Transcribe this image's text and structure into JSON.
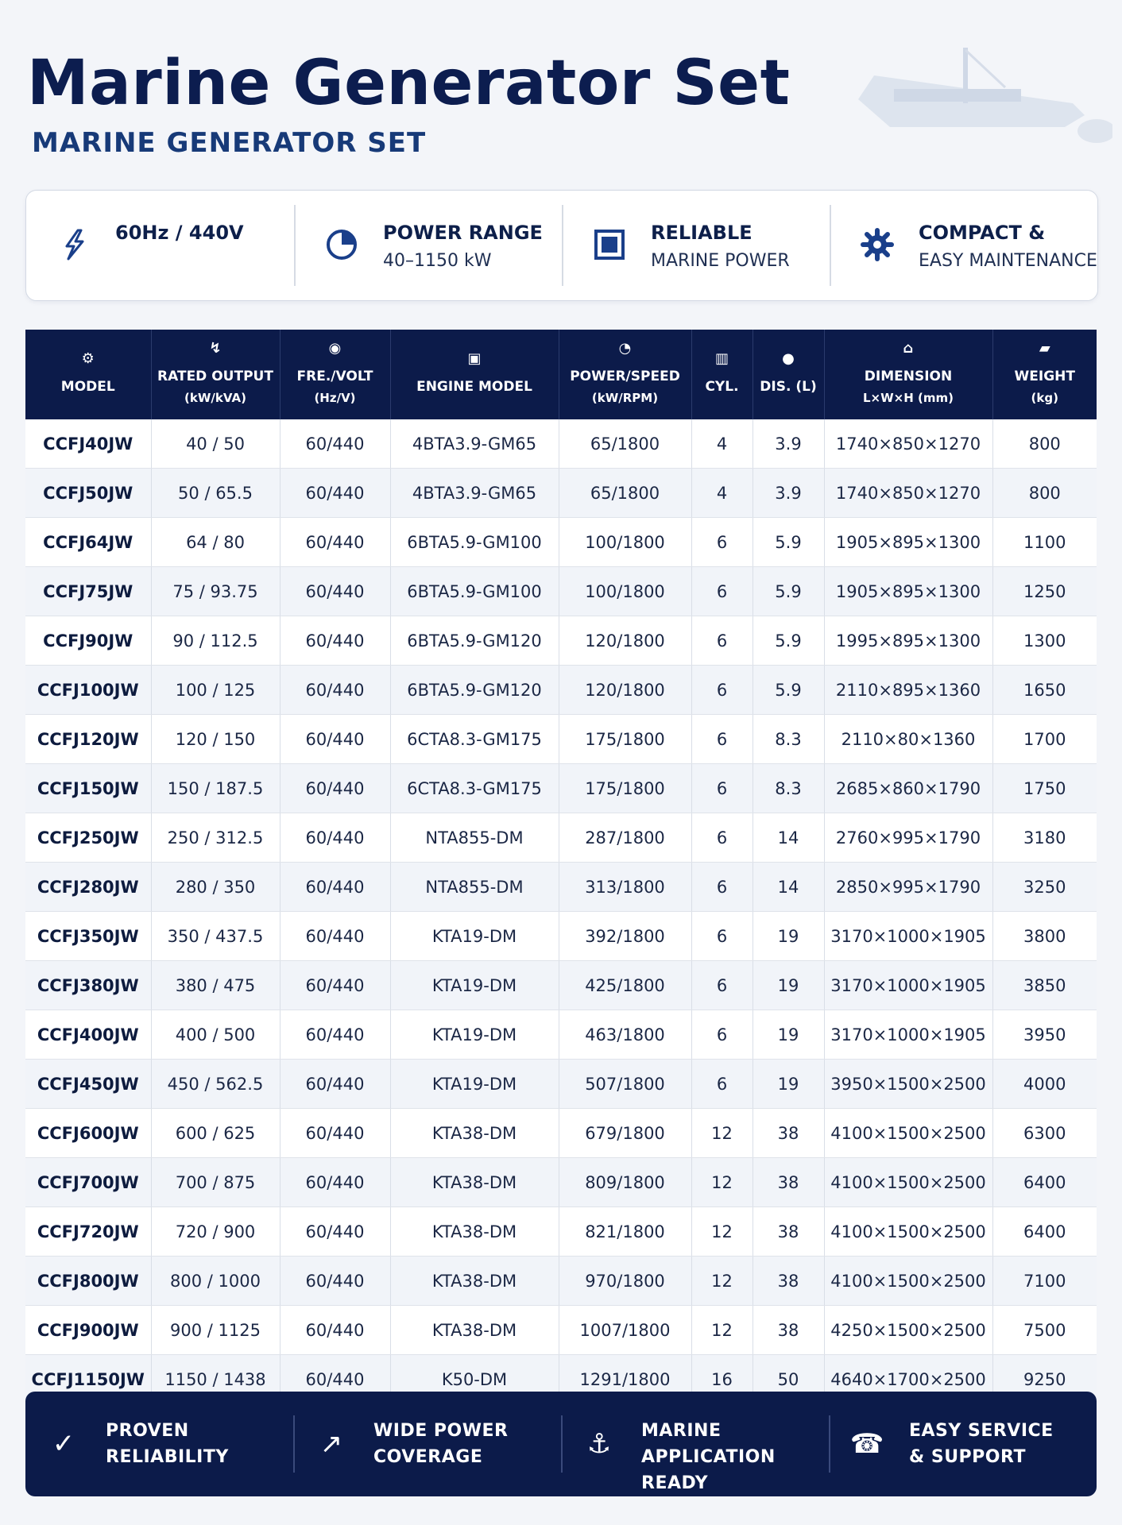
{
  "header": {
    "title": "Marine Generator Set",
    "subtitle": "MARINE GENERATOR SET"
  },
  "features": [
    {
      "icon": "lightning-icon",
      "title": "60Hz / 440V",
      "sub": ""
    },
    {
      "icon": "pie-chart-icon",
      "title": "POWER RANGE",
      "sub": "40–1150 kW"
    },
    {
      "icon": "square-icon",
      "title": "RELIABLE",
      "sub": "MARINE POWER"
    },
    {
      "icon": "gear-icon",
      "title": "COMPACT &",
      "sub": "EASY MAINTENANCE"
    }
  ],
  "table": {
    "headers": [
      {
        "icon": "⚙",
        "label": "MODEL",
        "sub": ""
      },
      {
        "icon": "↯",
        "label": "RATED OUTPUT",
        "sub": "(kW/kVA)"
      },
      {
        "icon": "◉",
        "label": "FRE./VOLT",
        "sub": "(Hz/V)"
      },
      {
        "icon": "▣",
        "label": "ENGINE MODEL",
        "sub": ""
      },
      {
        "icon": "◔",
        "label": "POWER/SPEED",
        "sub": "(kW/RPM)"
      },
      {
        "icon": "▥",
        "label": "CYL.",
        "sub": ""
      },
      {
        "icon": "●",
        "label": "DIS. (L)",
        "sub": ""
      },
      {
        "icon": "⌂",
        "label": "DIMENSION",
        "sub": "L×W×H (mm)"
      },
      {
        "icon": "▰",
        "label": "WEIGHT",
        "sub": "(kg)"
      }
    ],
    "rows": [
      [
        "CCFJ40JW",
        "40 / 50",
        "60/440",
        "4BTA3.9-GM65",
        "65/1800",
        "4",
        "3.9",
        "1740×850×1270",
        "800"
      ],
      [
        "CCFJ50JW",
        "50 / 65.5",
        "60/440",
        "4BTA3.9-GM65",
        "65/1800",
        "4",
        "3.9",
        "1740×850×1270",
        "800"
      ],
      [
        "CCFJ64JW",
        "64 / 80",
        "60/440",
        "6BTA5.9-GM100",
        "100/1800",
        "6",
        "5.9",
        "1905×895×1300",
        "1100"
      ],
      [
        "CCFJ75JW",
        "75 / 93.75",
        "60/440",
        "6BTA5.9-GM100",
        "100/1800",
        "6",
        "5.9",
        "1905×895×1300",
        "1250"
      ],
      [
        "CCFJ90JW",
        "90 / 112.5",
        "60/440",
        "6BTA5.9-GM120",
        "120/1800",
        "6",
        "5.9",
        "1995×895×1300",
        "1300"
      ],
      [
        "CCFJ100JW",
        "100 / 125",
        "60/440",
        "6BTA5.9-GM120",
        "120/1800",
        "6",
        "5.9",
        "2110×895×1360",
        "1650"
      ],
      [
        "CCFJ120JW",
        "120 / 150",
        "60/440",
        "6CTA8.3-GM175",
        "175/1800",
        "6",
        "8.3",
        "2110×80×1360",
        "1700"
      ],
      [
        "CCFJ150JW",
        "150 / 187.5",
        "60/440",
        "6CTA8.3-GM175",
        "175/1800",
        "6",
        "8.3",
        "2685×860×1790",
        "1750"
      ],
      [
        "CCFJ250JW",
        "250 / 312.5",
        "60/440",
        "NTA855-DM",
        "287/1800",
        "6",
        "14",
        "2760×995×1790",
        "3180"
      ],
      [
        "CCFJ280JW",
        "280 / 350",
        "60/440",
        "NTA855-DM",
        "313/1800",
        "6",
        "14",
        "2850×995×1790",
        "3250"
      ],
      [
        "CCFJ350JW",
        "350 / 437.5",
        "60/440",
        "KTA19-DM",
        "392/1800",
        "6",
        "19",
        "3170×1000×1905",
        "3800"
      ],
      [
        "CCFJ380JW",
        "380 / 475",
        "60/440",
        "KTA19-DM",
        "425/1800",
        "6",
        "19",
        "3170×1000×1905",
        "3850"
      ],
      [
        "CCFJ400JW",
        "400 / 500",
        "60/440",
        "KTA19-DM",
        "463/1800",
        "6",
        "19",
        "3170×1000×1905",
        "3950"
      ],
      [
        "CCFJ450JW",
        "450 / 562.5",
        "60/440",
        "KTA19-DM",
        "507/1800",
        "6",
        "19",
        "3950×1500×2500",
        "4000"
      ],
      [
        "CCFJ600JW",
        "600 / 625",
        "60/440",
        "KTA38-DM",
        "679/1800",
        "12",
        "38",
        "4100×1500×2500",
        "6300"
      ],
      [
        "CCFJ700JW",
        "700 / 875",
        "60/440",
        "KTA38-DM",
        "809/1800",
        "12",
        "38",
        "4100×1500×2500",
        "6400"
      ],
      [
        "CCFJ720JW",
        "720 / 900",
        "60/440",
        "KTA38-DM",
        "821/1800",
        "12",
        "38",
        "4100×1500×2500",
        "6400"
      ],
      [
        "CCFJ800JW",
        "800 / 1000",
        "60/440",
        "KTA38-DM",
        "970/1800",
        "12",
        "38",
        "4100×1500×2500",
        "7100"
      ],
      [
        "CCFJ900JW",
        "900 / 1125",
        "60/440",
        "KTA38-DM",
        "1007/1800",
        "12",
        "38",
        "4250×1500×2500",
        "7500"
      ],
      [
        "CCFJ1150JW",
        "1150 / 1438",
        "60/440",
        "K50-DM",
        "1291/1800",
        "16",
        "50",
        "4640×1700×2500",
        "9250"
      ]
    ]
  },
  "footer": [
    {
      "icon": "✓",
      "icon_name": "checkmark-icon",
      "line1": "PROVEN",
      "line2": "RELIABILITY"
    },
    {
      "icon": "↗",
      "icon_name": "arrow-up-right-icon",
      "line1": "WIDE POWER",
      "line2": "COVERAGE"
    },
    {
      "icon": "⚓",
      "icon_name": "anchor-icon",
      "line1": "MARINE",
      "line2": "APPLICATION READY"
    },
    {
      "icon": "☎",
      "icon_name": "telephone-icon",
      "line1": "EASY SERVICE",
      "line2": "& SUPPORT"
    }
  ],
  "colors": {
    "navy": "#0c1b4a",
    "title": "#0c1d4f",
    "subtitle": "#173a78",
    "accent": "#1a3f8a"
  }
}
